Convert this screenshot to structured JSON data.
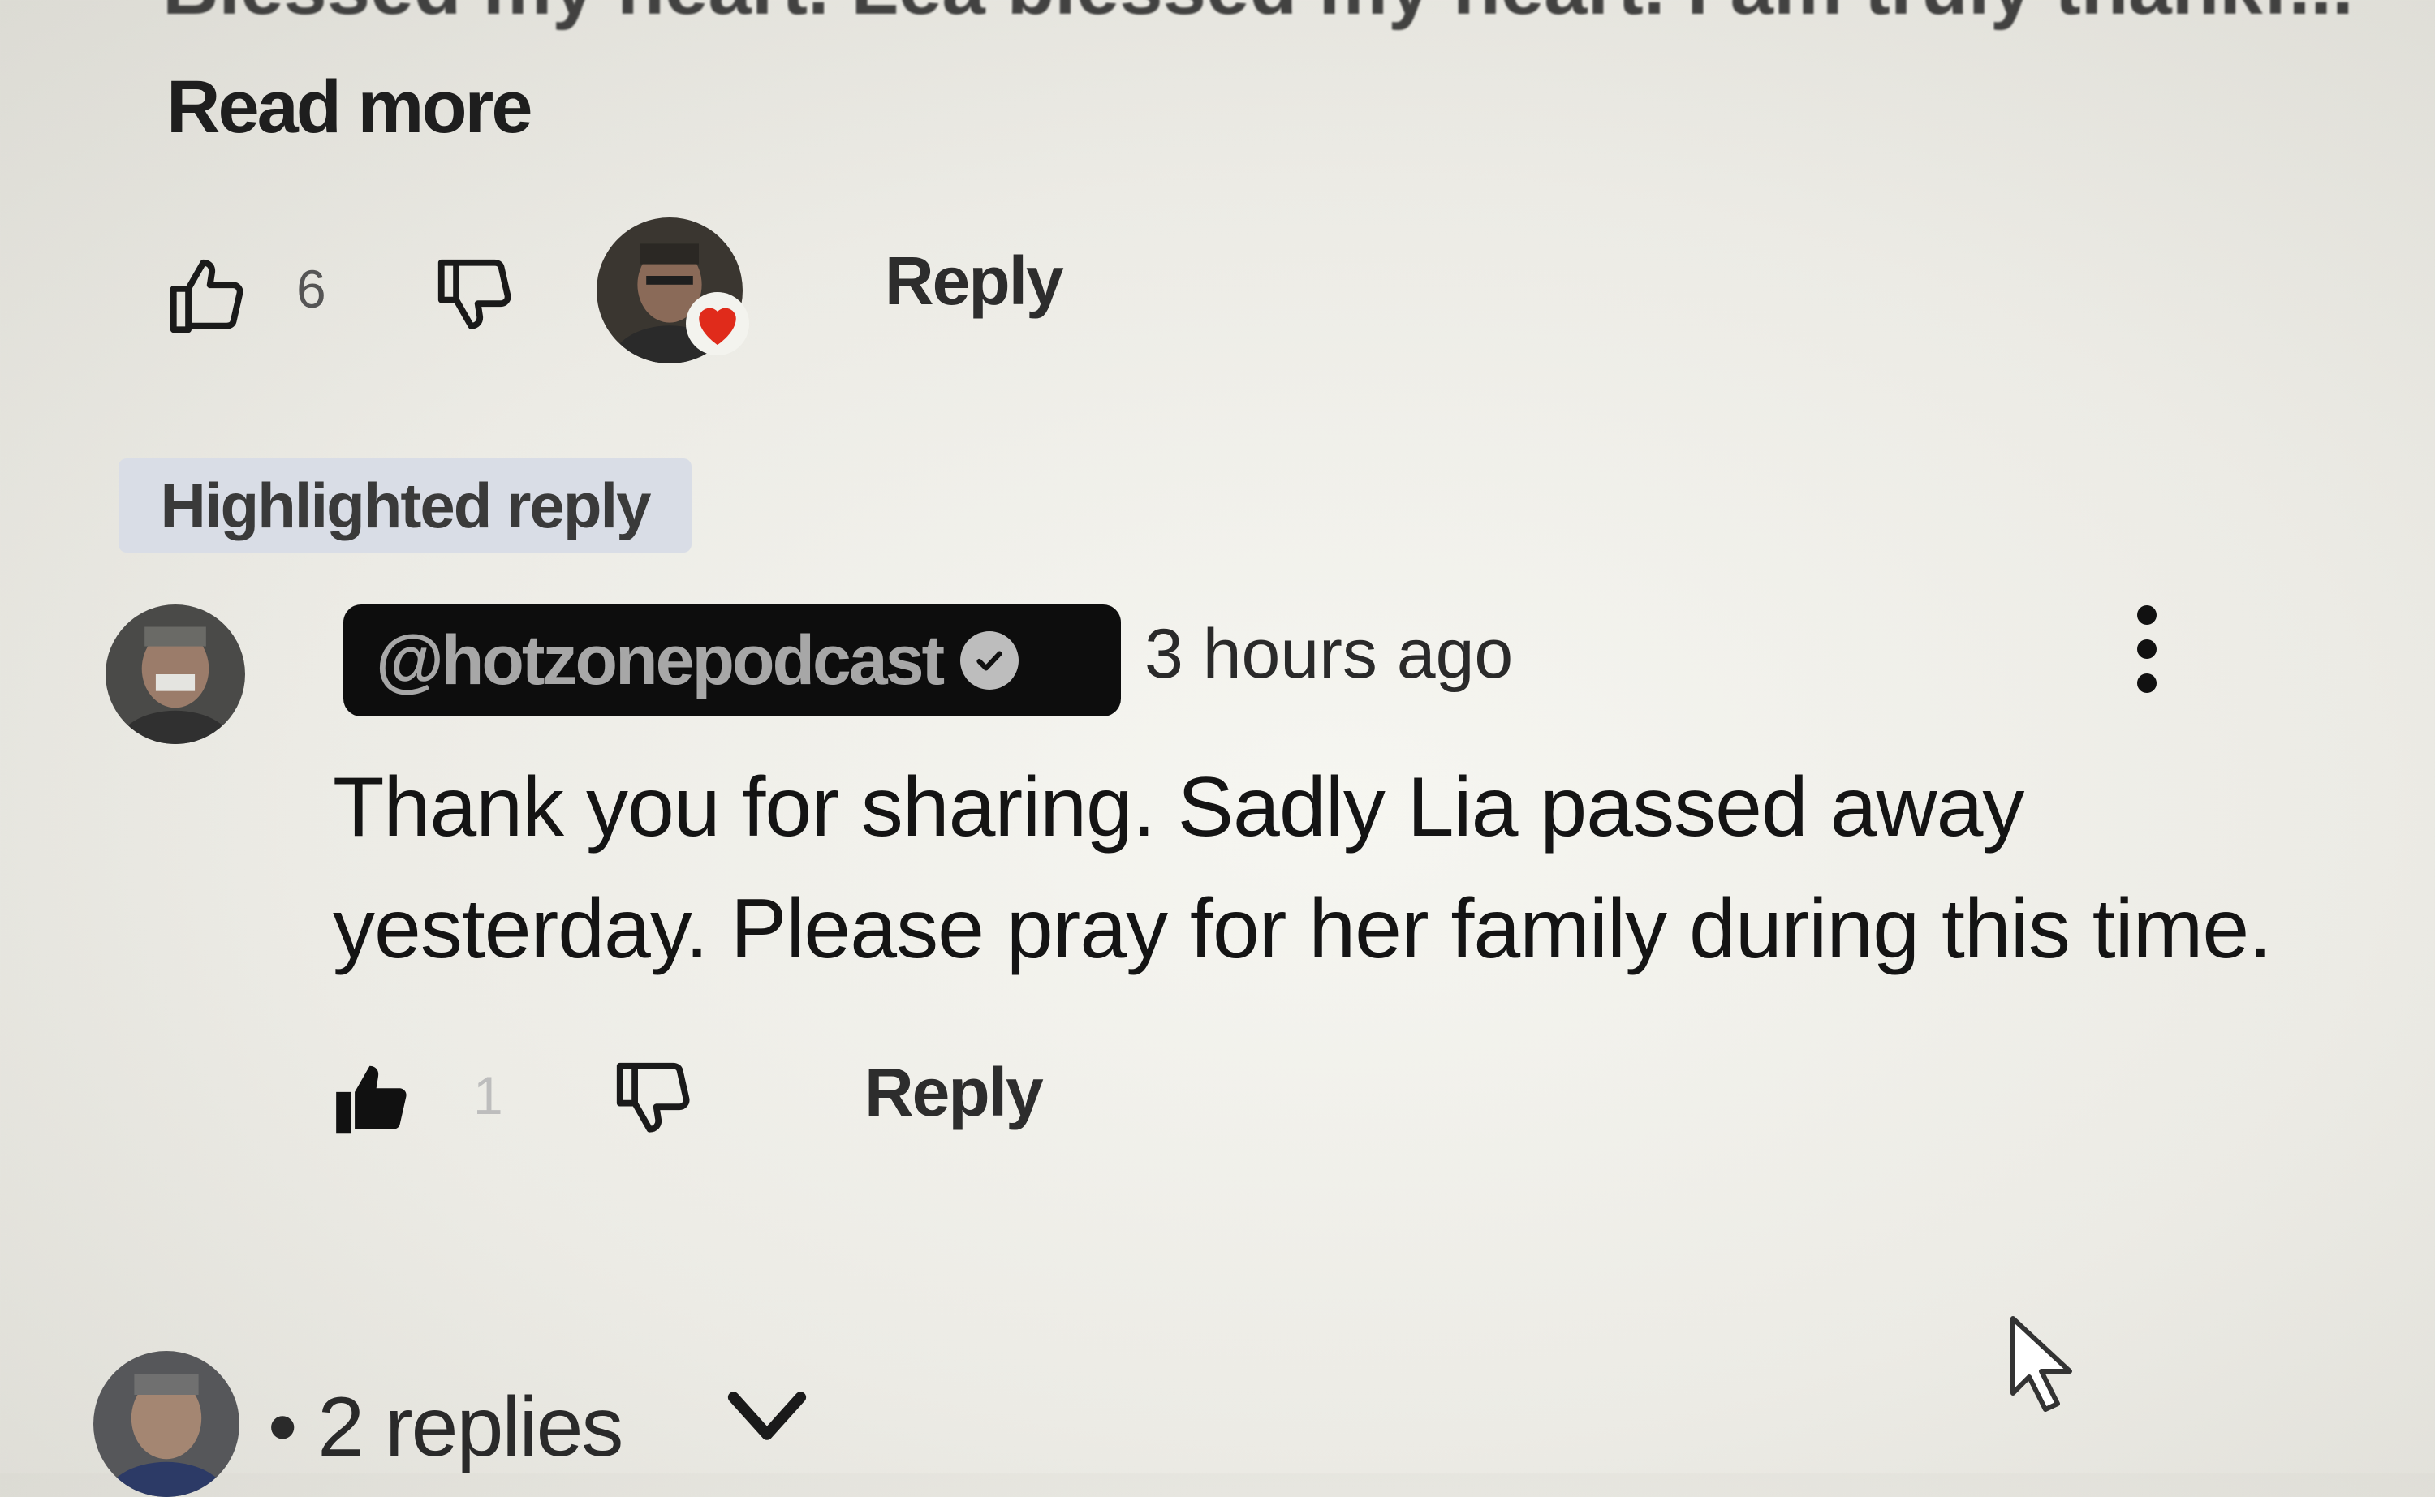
{
  "prev_comment": {
    "cut_text": "Blessed my heart. Lea blessed my heart. I am truly thankf...",
    "read_more_label": "Read more",
    "like_count": "6",
    "reply_label": "Reply"
  },
  "highlight_badge": "Highlighted reply",
  "reply_comment": {
    "author": "@hotzonepodcast",
    "timestamp": "3 hours ago",
    "text": "Thank you for sharing. Sadly Lia passed away yesterday. Please pray for her family during this time.",
    "like_count": "1",
    "reply_label": "Reply"
  },
  "replies_toggle": {
    "label": "• 2 replies"
  },
  "colors": {
    "author_pill_bg": "#0d0d0d",
    "heart_red": "#e02b1b",
    "badge_bg": "#d9dde6"
  },
  "icons": {
    "like_outline": "thumbs-up-outline-icon",
    "dislike_outline": "thumbs-down-outline-icon",
    "like_filled": "thumbs-up-filled-icon",
    "more": "three-dots-vertical-icon",
    "expand": "chevron-down-icon",
    "verified": "verified-check-icon",
    "cursor": "mouse-pointer-icon"
  }
}
